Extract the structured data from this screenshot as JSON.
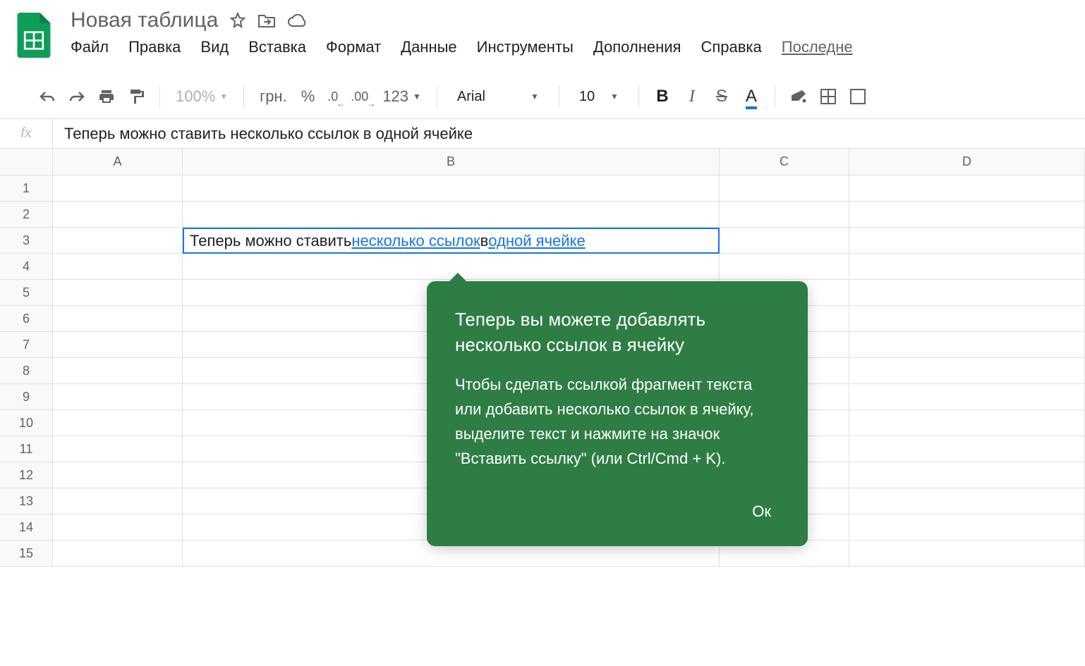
{
  "header": {
    "title": "Новая таблица",
    "menu": [
      "Файл",
      "Правка",
      "Вид",
      "Вставка",
      "Формат",
      "Данные",
      "Инструменты",
      "Дополнения",
      "Справка",
      "Последне"
    ]
  },
  "toolbar": {
    "zoom": "100%",
    "currency": "грн.",
    "percent": "%",
    "dec_dec": ".0",
    "dec_inc": ".00",
    "format_123": "123",
    "font": "Arial",
    "font_size": "10",
    "bold": "B",
    "italic": "I",
    "strike": "S",
    "text_color": "A"
  },
  "formula_bar": {
    "fx": "fx",
    "value": "Теперь можно ставить несколько ссылок в одной ячейке"
  },
  "columns": [
    "A",
    "B",
    "C",
    "D"
  ],
  "rows": [
    "1",
    "2",
    "3",
    "4",
    "5",
    "6",
    "7",
    "8",
    "9",
    "10",
    "11",
    "12",
    "13",
    "14",
    "15"
  ],
  "selected_cell": {
    "text_before": "Теперь можно ставить ",
    "link1": "несколько ссылок",
    "text_mid": " в ",
    "link2": "одной ячейке"
  },
  "tooltip": {
    "title": "Теперь вы можете добавлять несколько ссылок в ячейку",
    "body": "Чтобы сделать ссылкой фрагмент текста или добавить несколько ссылок в ячейку, выделите текст и нажмите на значок \"Вставить ссылку\" (или Ctrl/Cmd + K).",
    "ok": "Ок"
  }
}
